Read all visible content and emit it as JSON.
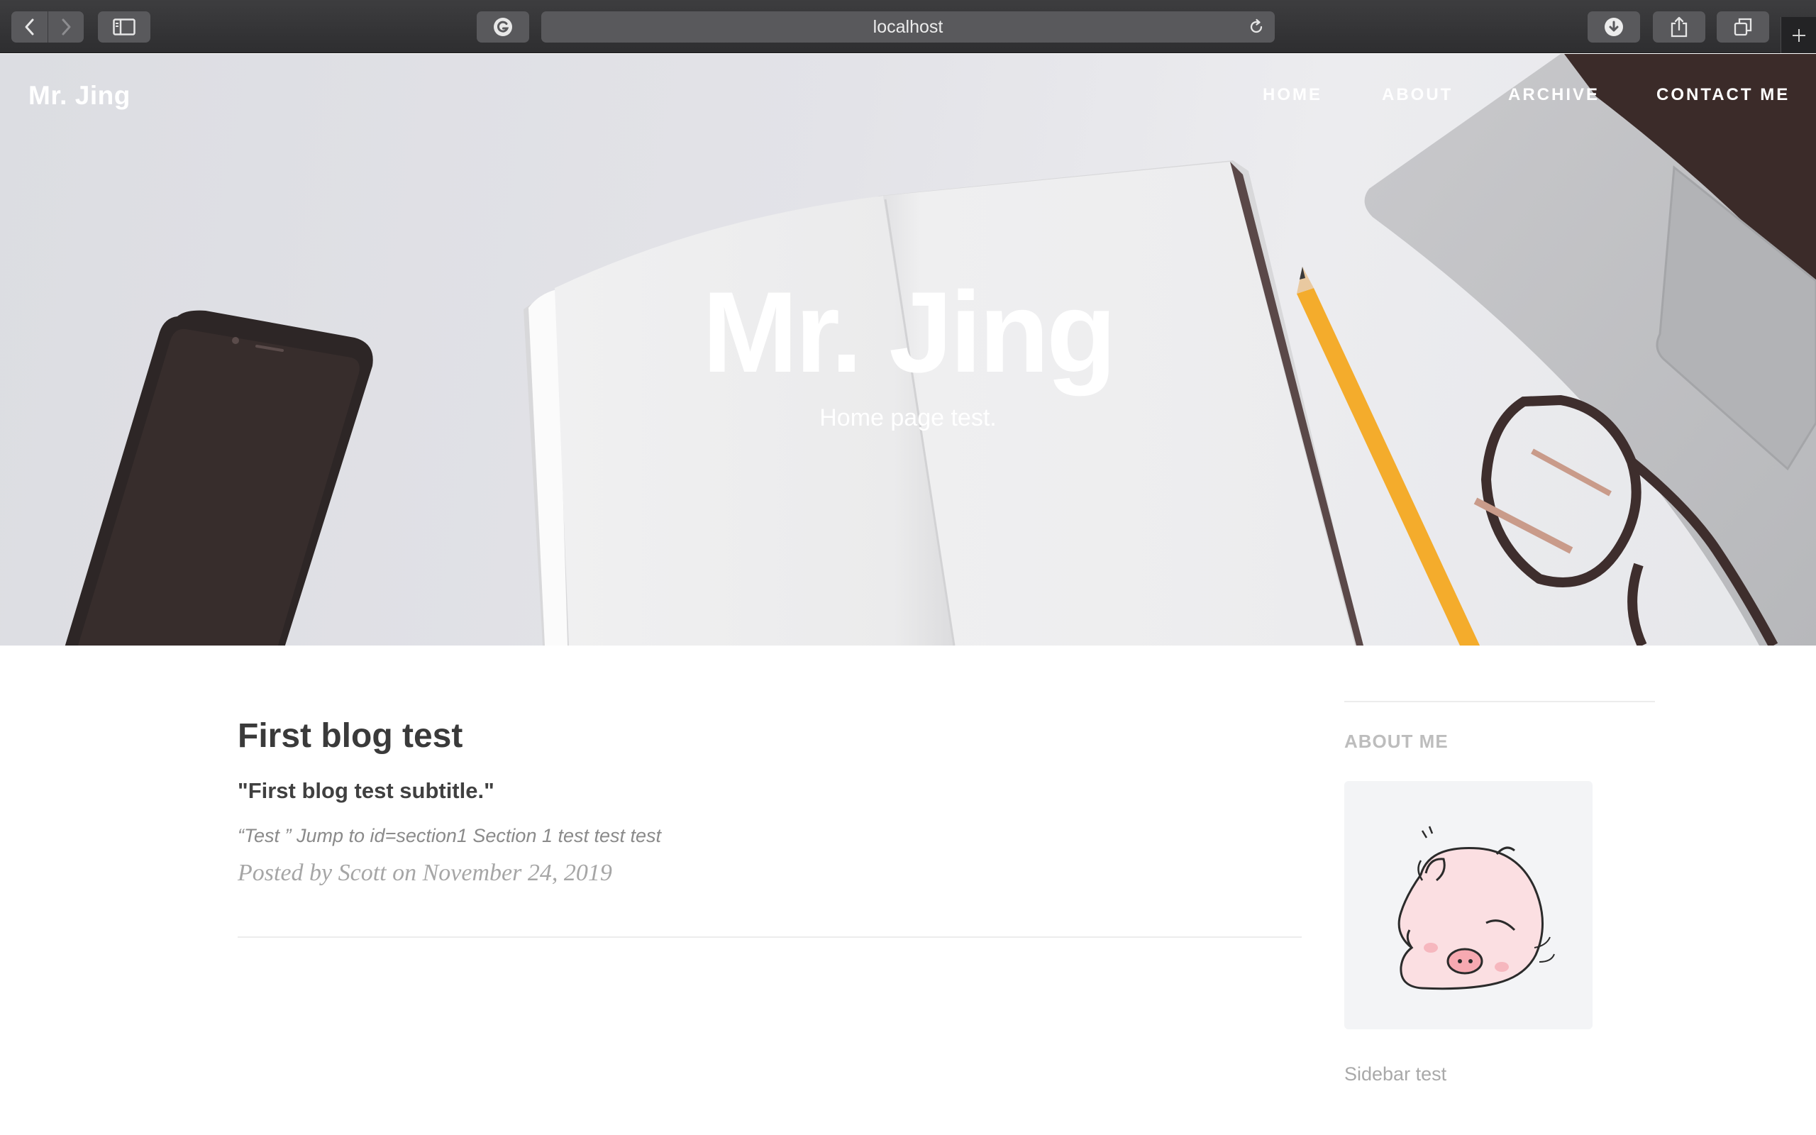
{
  "browser": {
    "url": "localhost",
    "icons": [
      "back-arrow-icon",
      "forward-arrow-icon",
      "sidebar-icon",
      "grammarly-icon",
      "reload-icon",
      "download-icon",
      "share-icon",
      "tabs-icon",
      "new-tab-plus-icon"
    ]
  },
  "site": {
    "brand": "Mr. Jing",
    "nav": [
      "HOME",
      "ABOUT",
      "ARCHIVE",
      "CONTACT ME"
    ],
    "hero_title": "Mr. Jing",
    "hero_subtitle": "Home page test."
  },
  "post": {
    "title": "First blog test",
    "subtitle": "\"First blog test subtitle.\"",
    "excerpt": "“Test ” Jump to id=section1 Section 1 test test test",
    "meta": "Posted by Scott on November 24, 2019"
  },
  "sidebar": {
    "heading": "ABOUT ME",
    "avatar_icon": "pig-avatar",
    "text": "Sidebar test"
  },
  "colors": {
    "toolbar": "#2e2e30",
    "hero_bg": "#e3e3e8",
    "pencil": "#f4ac2c",
    "text_dark": "#3a3a3a",
    "text_muted": "#a6a6a6"
  }
}
